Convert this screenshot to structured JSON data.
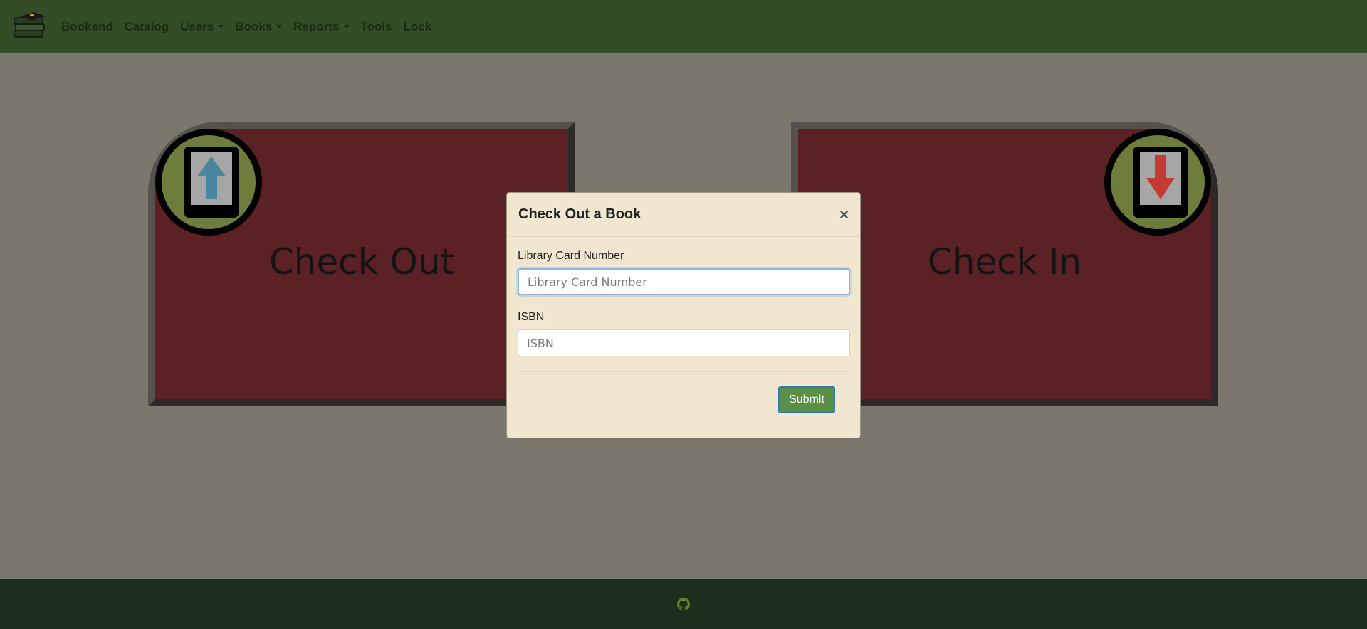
{
  "nav": {
    "brand": "Bookend",
    "items": [
      {
        "label": "Catalog",
        "dropdown": false
      },
      {
        "label": "Users",
        "dropdown": true
      },
      {
        "label": "Books",
        "dropdown": true
      },
      {
        "label": "Reports",
        "dropdown": true
      },
      {
        "label": "Tools",
        "dropdown": false
      },
      {
        "label": "Lock",
        "dropdown": false
      }
    ]
  },
  "cards": {
    "checkout": {
      "title": "Check Out",
      "icon": "phone-upload-icon",
      "arrow_color": "#4a86a0"
    },
    "checkin": {
      "title": "Check In",
      "icon": "phone-download-icon",
      "arrow_color": "#c33a33"
    }
  },
  "modal": {
    "title": "Check Out a Book",
    "close": "×",
    "fields": {
      "card_number": {
        "label": "Library Card Number",
        "placeholder": "Library Card Number",
        "value": ""
      },
      "isbn": {
        "label": "ISBN",
        "placeholder": "ISBN",
        "value": ""
      }
    },
    "submit_label": "Submit"
  },
  "footer": {
    "icon": "github-icon"
  },
  "colors": {
    "navbar": "#344d27",
    "background": "#7c776c",
    "card": "#5c2124",
    "modal": "#f1e7d0",
    "submit": "#5a9046",
    "footer": "#1c2e1c"
  }
}
